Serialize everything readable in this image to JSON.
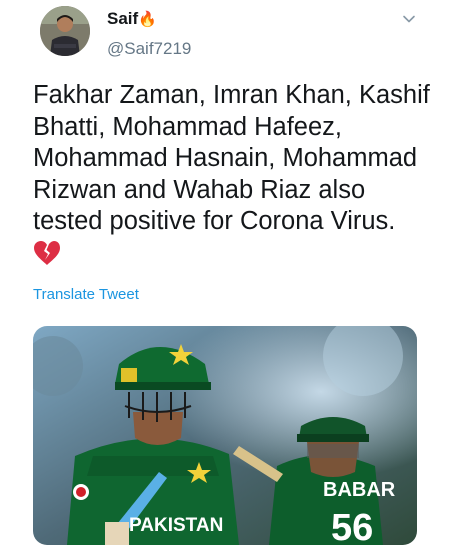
{
  "tweet": {
    "author_name": "Saif",
    "author_emoji": "🔥",
    "handle": "@Saif7219",
    "text": "Fakhar Zaman, Imran Khan, Kashif Bhatti, Mohammad Hafeez, Mohammad Hasnain, Mohammad Rizwan and Wahab Riaz also tested positive for Corona Virus.",
    "text_emoji": "💔",
    "translate_label": "Translate Tweet"
  },
  "media": {
    "jersey_text": "PAKISTAN",
    "player2_name": "BABAR",
    "player2_number": "56"
  },
  "icons": {
    "menu": "chevron-down-icon",
    "emoji": "broken-heart-icon"
  },
  "colors": {
    "link": "#1b95e0",
    "muted": "#657786",
    "jersey": "#0d5e2c"
  }
}
